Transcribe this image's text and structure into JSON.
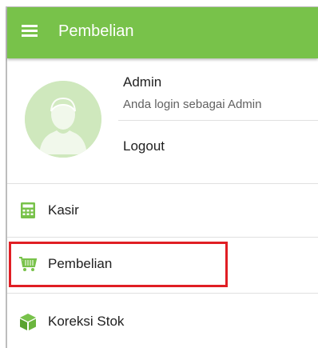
{
  "appbar": {
    "title": "Pembelian",
    "color": "#78c24a"
  },
  "profile": {
    "name": "Admin",
    "subtitle": "Anda login sebagai Admin",
    "logout_label": "Logout"
  },
  "menu": [
    {
      "label": "Kasir",
      "icon": "calculator-icon"
    },
    {
      "label": "Pembelian",
      "icon": "shopping-cart-icon",
      "highlighted": true
    },
    {
      "label": "Koreksi Stok",
      "icon": "box-icon"
    }
  ],
  "highlight_color": "#e01e24"
}
